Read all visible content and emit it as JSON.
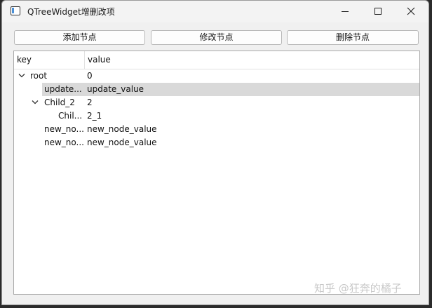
{
  "window": {
    "title": "QTreeWidget增删改项"
  },
  "toolbar": {
    "add_label": "添加节点",
    "edit_label": "修改节点",
    "delete_label": "删除节点"
  },
  "tree": {
    "headers": [
      "key",
      "value"
    ],
    "rows": [
      {
        "key": "root",
        "value": "0",
        "depth": 0,
        "expanded": true
      },
      {
        "key": "update...",
        "value": "update_value",
        "depth": 1,
        "selected": true
      },
      {
        "key": "Child_2",
        "value": "2",
        "depth": 1,
        "expanded": true
      },
      {
        "key": "Chil...",
        "value": "2_1",
        "depth": 2
      },
      {
        "key": "new_no...",
        "value": "new_node_value",
        "depth": 1
      },
      {
        "key": "new_no...",
        "value": "new_node_value",
        "depth": 1
      }
    ]
  },
  "watermark": "知乎 @狂奔的橘子",
  "colors": {
    "selection": "#d9d9d9",
    "window_bg": "#f0f0f0"
  }
}
